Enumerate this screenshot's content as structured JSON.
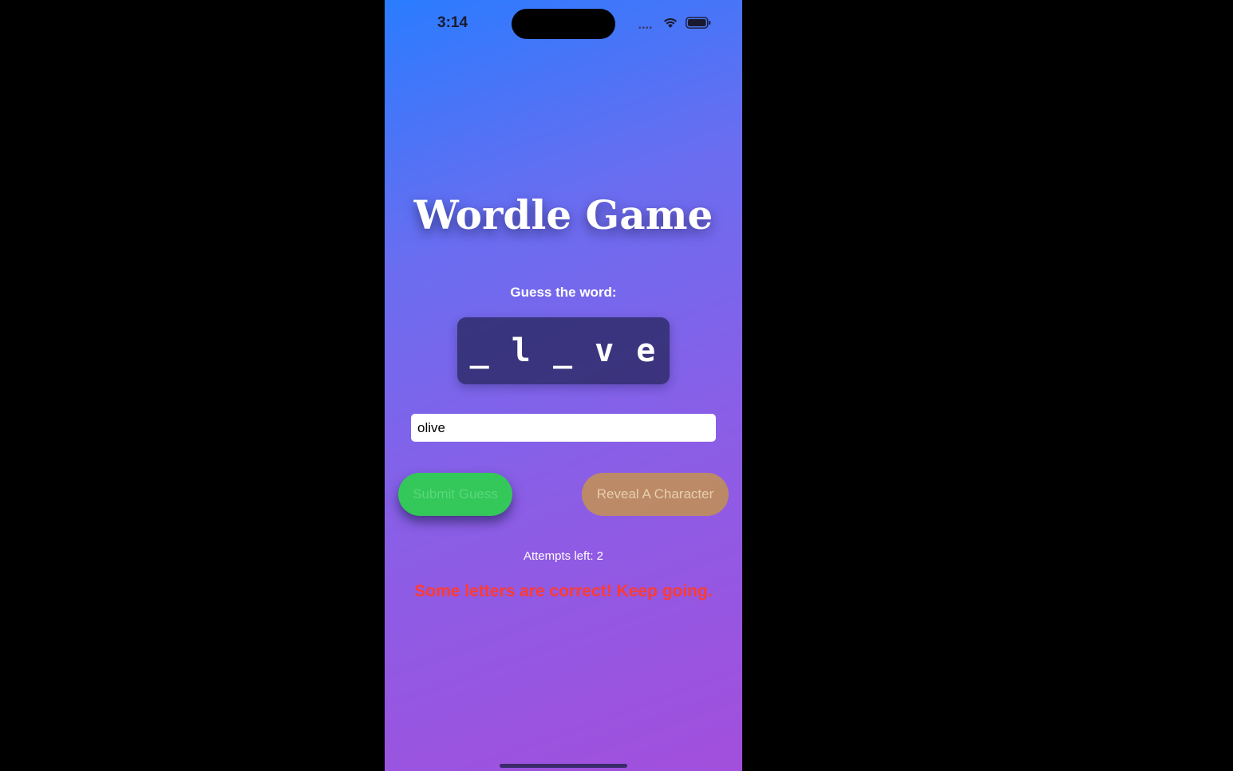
{
  "status_bar": {
    "time": "3:14",
    "signal": "••••",
    "wifi_icon": "wifi-icon",
    "battery_icon": "battery-icon"
  },
  "game": {
    "title": "Wordle Game",
    "prompt": "Guess the word:",
    "masked_word": "_ l _ v e",
    "input": {
      "value": "olive",
      "placeholder": ""
    },
    "buttons": {
      "submit_label": "Submit Guess",
      "reveal_label": "Reveal A Character"
    },
    "attempts": "Attempts left: 2",
    "feedback": "Some letters are correct! Keep going."
  },
  "colors": {
    "gradient_top": "#2a7cff",
    "gradient_bottom": "#a24fdc",
    "submit_bg": "#34c759",
    "reveal_bg": "#c49250",
    "feedback_text": "#ff3b30"
  }
}
